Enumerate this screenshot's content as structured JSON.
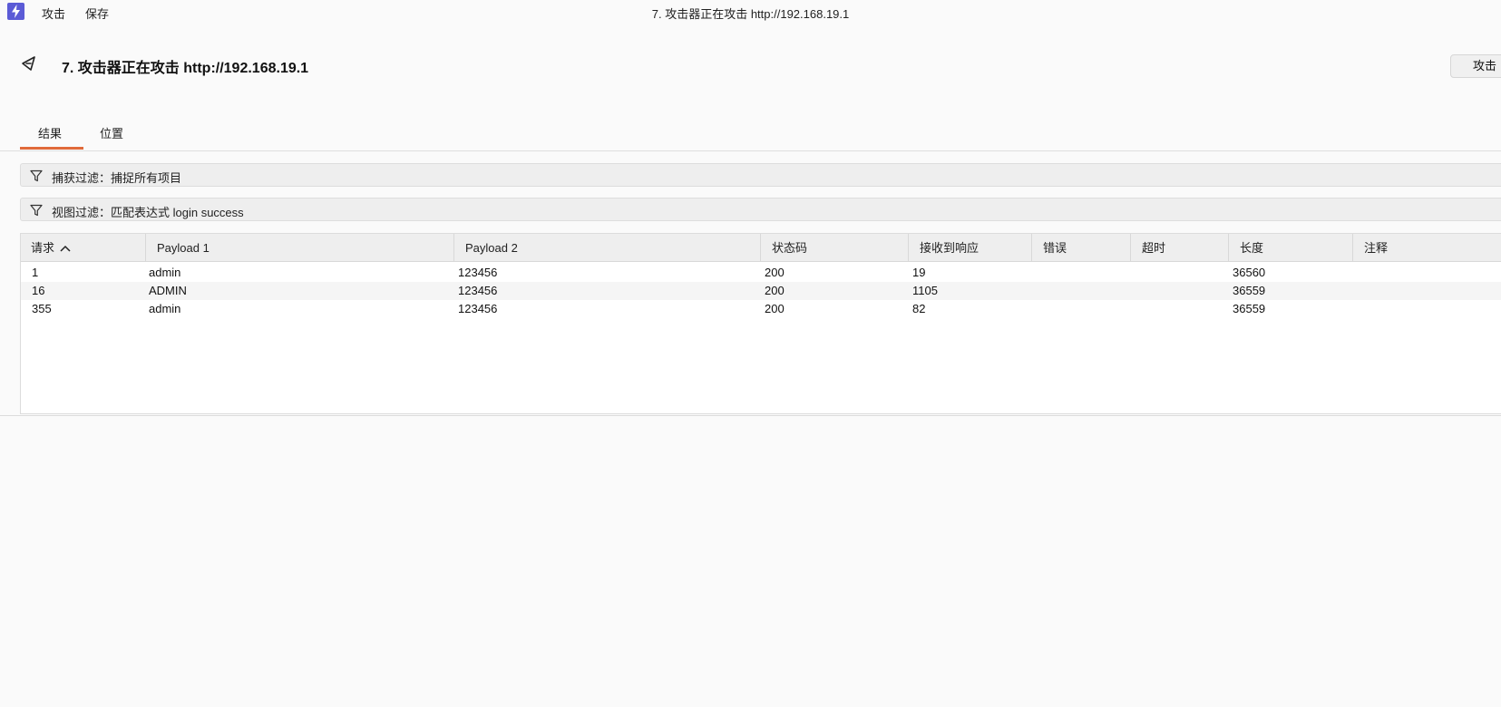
{
  "menu": {
    "items": [
      "攻击",
      "保存"
    ],
    "window_title": "7. 攻击器正在攻击 http://192.168.19.1"
  },
  "header": {
    "title": "7. 攻击器正在攻击 http://192.168.19.1",
    "attack_button": "攻击"
  },
  "tabs": [
    {
      "label": "结果",
      "active": true
    },
    {
      "label": "位置",
      "active": false
    }
  ],
  "filters": {
    "capture": "捕获过滤：捕捉所有项目",
    "view": "视图过滤：匹配表达式 login success"
  },
  "table": {
    "columns": [
      "请求",
      "Payload 1",
      "Payload 2",
      "状态码",
      "接收到响应",
      "错误",
      "超时",
      "长度",
      "注释"
    ],
    "sort_column": "请求",
    "sort_direction": "ascending",
    "rows": [
      [
        "1",
        "admin",
        "123456",
        "200",
        "19",
        "",
        "",
        "36560",
        ""
      ],
      [
        "16",
        "ADMIN",
        "123456",
        "200",
        "1105",
        "",
        "",
        "36559",
        ""
      ],
      [
        "355",
        "admin",
        "123456",
        "200",
        "82",
        "",
        "",
        "36559",
        ""
      ]
    ]
  },
  "colors": {
    "accent": "#e06a3a",
    "app_icon": "#5b5bd6"
  }
}
